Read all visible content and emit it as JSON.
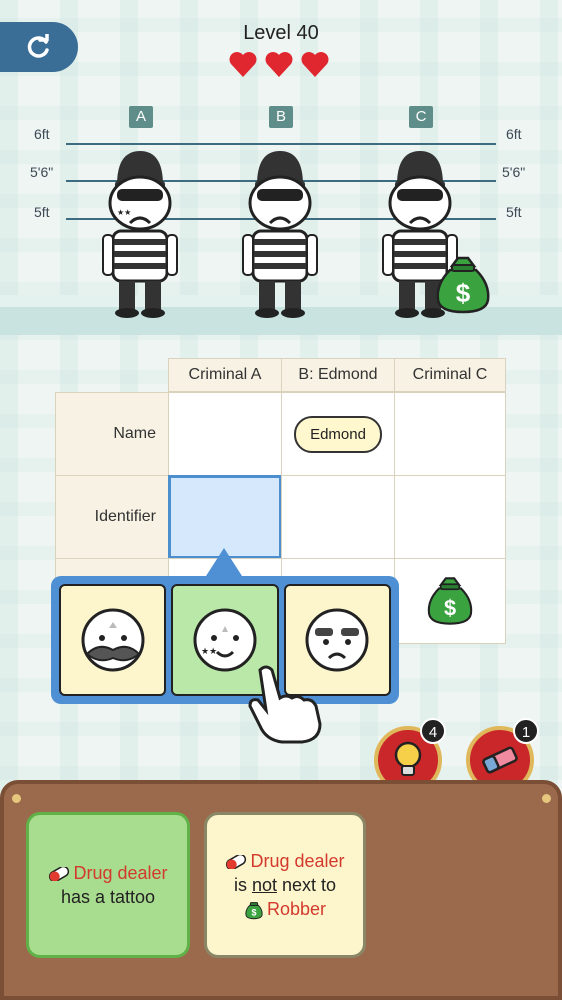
{
  "header": {
    "level_title": "Level 40",
    "lives": 3
  },
  "lineup": {
    "tags": [
      "A",
      "B",
      "C"
    ],
    "height_marks_left": [
      "6ft",
      "5'6\"",
      "5ft"
    ],
    "height_marks_right": [
      "6ft",
      "5'6\"",
      "5ft"
    ]
  },
  "grid": {
    "columns": [
      "Criminal A",
      "B: Edmond",
      "Criminal C"
    ],
    "rows": [
      "Name",
      "Identifier"
    ],
    "name_value_b": "Edmond"
  },
  "hints": {
    "hint_count": "4",
    "eraser_count": "1"
  },
  "clues": {
    "clue1": {
      "role": "Drug dealer",
      "text": "has a tattoo"
    },
    "clue2": {
      "role": "Drug dealer",
      "pre": "is ",
      "neg": "not",
      "post": " next to",
      "role2": "Robber"
    }
  },
  "colors": {
    "accent_blue": "#4f90d4",
    "heart_red": "#e0262e",
    "clue_red": "#d33a2e"
  }
}
